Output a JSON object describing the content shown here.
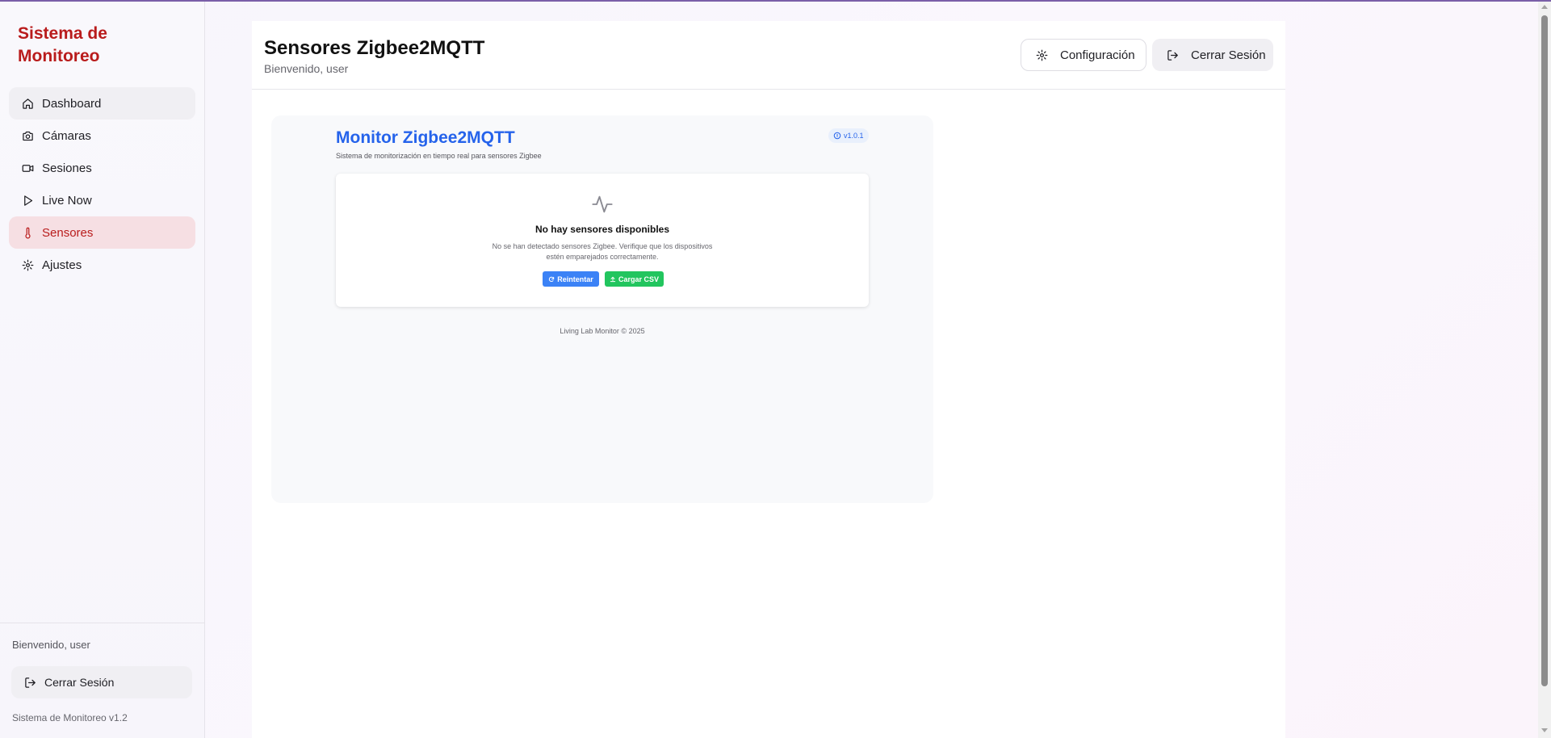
{
  "sidebar": {
    "brand": "Sistema de Monitoreo",
    "items": [
      {
        "label": "Dashboard",
        "icon": "home-icon"
      },
      {
        "label": "Cámaras",
        "icon": "camera-icon"
      },
      {
        "label": "Sesiones",
        "icon": "video-icon"
      },
      {
        "label": "Live Now",
        "icon": "play-icon"
      },
      {
        "label": "Sensores",
        "icon": "thermometer-icon",
        "active": true
      },
      {
        "label": "Ajustes",
        "icon": "gear-icon"
      }
    ],
    "welcome": "Bienvenido, user",
    "logout_label": "Cerrar Sesión",
    "version": "Sistema de Monitoreo v1.2"
  },
  "header": {
    "title": "Sensores Zigbee2MQTT",
    "subtitle": "Bienvenido, user",
    "config_label": "Configuración",
    "logout_label": "Cerrar Sesión"
  },
  "monitor": {
    "title": "Monitor Zigbee2MQTT",
    "subtitle": "Sistema de monitorización en tiempo real para sensores Zigbee",
    "version": "v1.0.1",
    "empty_title": "No hay sensores disponibles",
    "empty_desc": "No se han detectado sensores Zigbee. Verifique que los dispositivos estén emparejados correctamente.",
    "retry_label": "Reintentar",
    "csv_label": "Cargar CSV",
    "footer": "Living Lab Monitor © 2025"
  },
  "colors": {
    "brand": "#b91c1c",
    "accent_blue": "#2563eb",
    "retry_bg": "#3b82f6",
    "csv_bg": "#22c55e",
    "active_nav_bg": "#f6dfe3"
  }
}
